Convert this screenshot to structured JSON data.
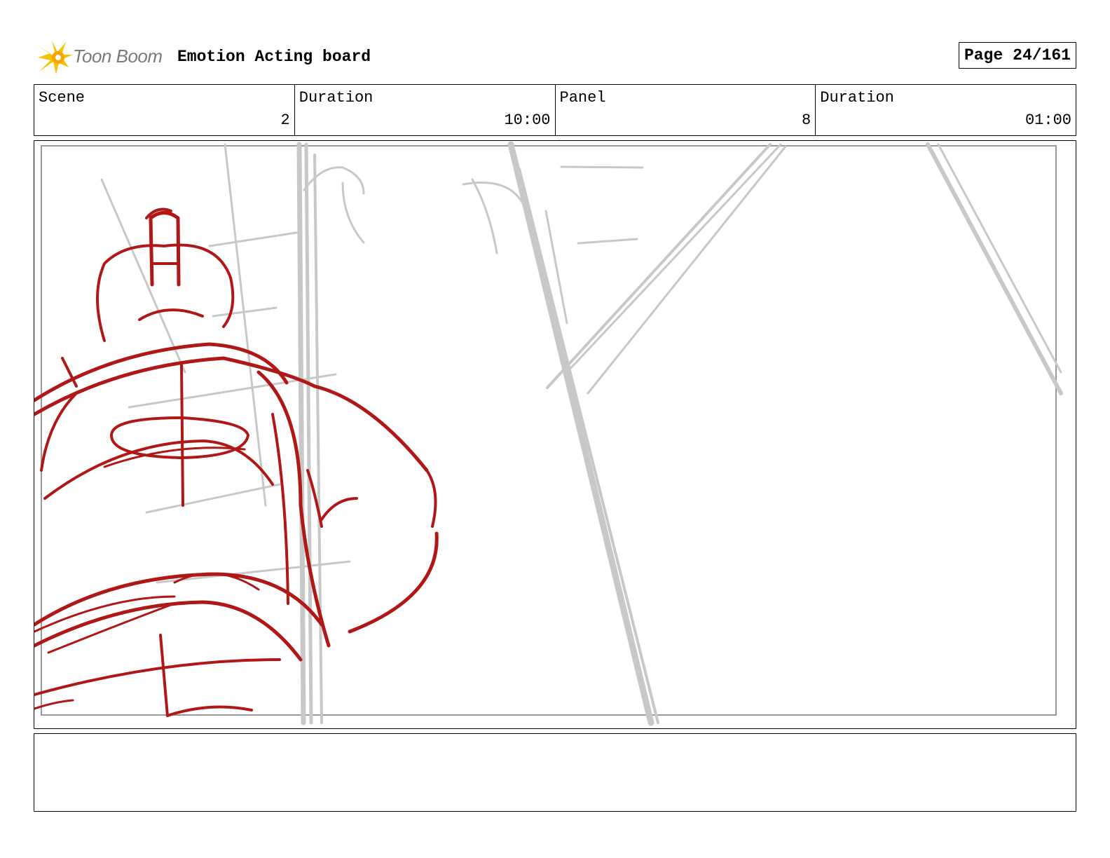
{
  "header": {
    "logo_text": "Toon Boom",
    "title": "Emotion Acting board",
    "page_label": "Page",
    "page_value": "24/161"
  },
  "info": {
    "scene_label": "Scene",
    "scene_value": "2",
    "scene_duration_label": "Duration",
    "scene_duration_value": "10:00",
    "panel_label": "Panel",
    "panel_value": "8",
    "panel_duration_label": "Duration",
    "panel_duration_value": "01:00"
  },
  "colors": {
    "sketch_red": "#b01818",
    "sketch_gray": "#c8c8c8",
    "logo_yellow": "#f5c400",
    "logo_text": "#7a7a7a"
  },
  "notes": {
    "text": ""
  }
}
